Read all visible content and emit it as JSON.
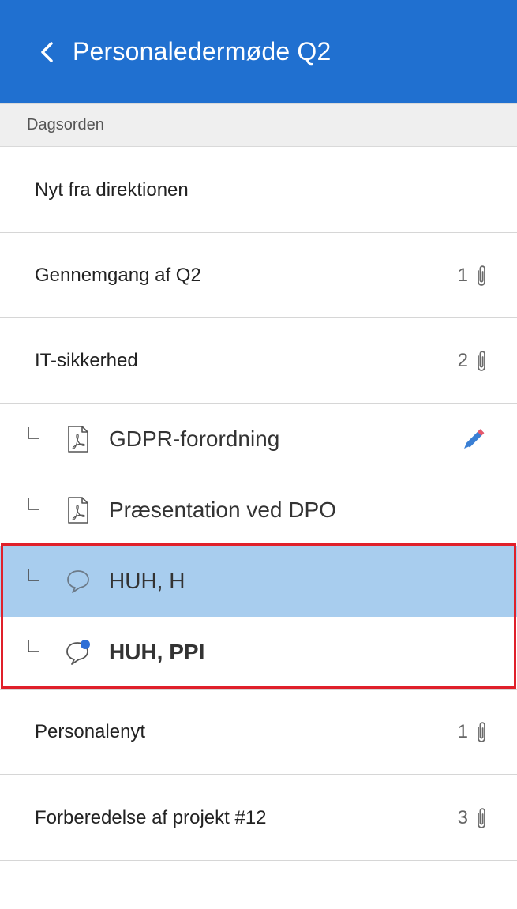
{
  "header": {
    "title": "Personaledermøde Q2",
    "back_icon": "chevron-left-icon"
  },
  "section": {
    "label": "Dagsorden"
  },
  "agenda": [
    {
      "label": "Nyt fra direktionen",
      "count": ""
    },
    {
      "label": "Gennemgang af Q2",
      "count": "1"
    },
    {
      "label": "IT-sikkerhed",
      "count": "2"
    }
  ],
  "sub_items": [
    {
      "label": "GDPR-forordning",
      "icon": "pdf-icon",
      "action_icon": "pencil-icon"
    },
    {
      "label": "Præsentation ved DPO",
      "icon": "pdf-icon"
    },
    {
      "label": "HUH, H",
      "icon": "comment-icon",
      "selected": true
    },
    {
      "label": "HUH, PPI",
      "icon": "comment-unread-icon",
      "unread": true
    }
  ],
  "agenda_after": [
    {
      "label": "Personalenyt",
      "count": "1"
    },
    {
      "label": "Forberedelse af projekt #12",
      "count": "3"
    }
  ],
  "colors": {
    "header": "#2070d0",
    "selected": "#a8cdee",
    "highlight": "#e0202a",
    "unread_dot": "#2f6fd6"
  }
}
